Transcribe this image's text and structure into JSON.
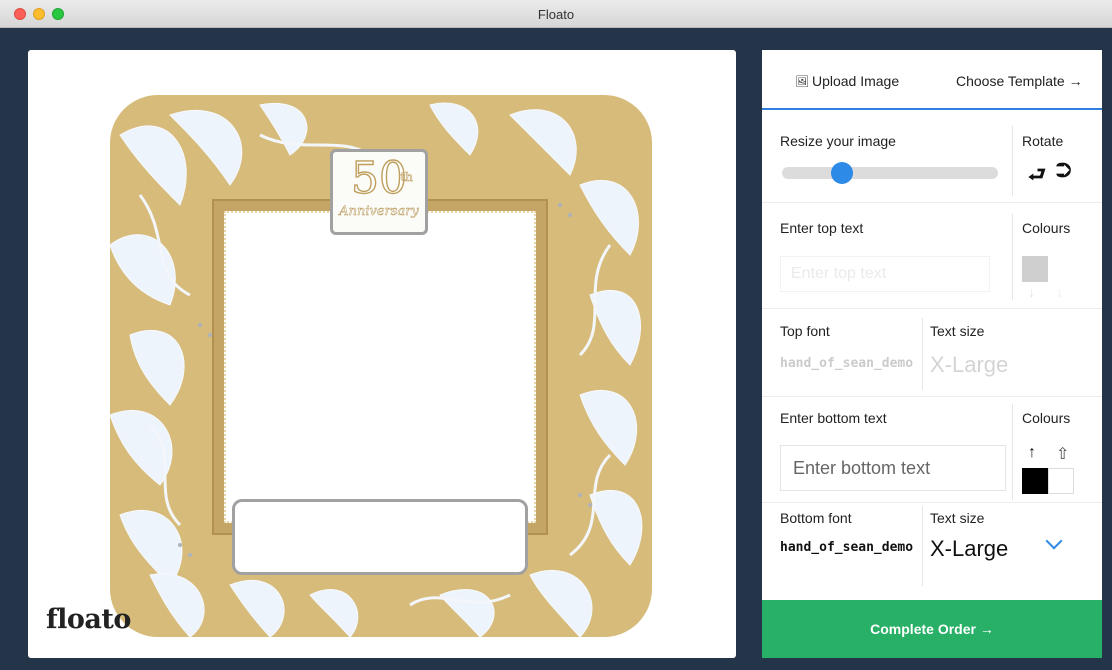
{
  "window": {
    "title": "Floato"
  },
  "design": {
    "badge_number": "50",
    "badge_suffix": "th",
    "badge_word": "Anniversary",
    "logo": "floato",
    "colors": {
      "gold": "#d6bb7b",
      "leaf": "#eef4fb",
      "frame": "#c5a566"
    }
  },
  "tabs": {
    "upload_label": "Upload Image",
    "upload_icon": "image-icon",
    "template_label": "Choose Template →"
  },
  "controls": {
    "resize_label": "Resize your image",
    "resize_level_percent": 25,
    "rotate_label": "Rotate",
    "rotate_left_glyph": "⮐",
    "rotate_right_glyph": "⮊",
    "top_text_label": "Enter top text",
    "top_text_placeholder": "Enter top text",
    "colours_label": "Colours",
    "top_font_label": "Top font",
    "top_font_value": "hand_of_sean_demo",
    "text_size_label": "Text size",
    "top_text_size_value": "X-Large",
    "bottom_text_label": "Enter bottom text",
    "bottom_text_placeholder": "Enter bottom text",
    "bottom_font_label": "Bottom font",
    "bottom_font_value": "hand_of_sean_demo",
    "bottom_text_size_value": "X-Large",
    "arrow_up_solid": "↑",
    "arrow_up_outline": "⇧",
    "arrow_down": "↓",
    "swatch_colors": {
      "top_grey": "#cfcfcf",
      "bottom_black": "#000000",
      "bottom_white": "#ffffff"
    }
  },
  "complete_button": "Complete Order →",
  "accent_colors": {
    "tab_underline": "#2f7fe0",
    "slider": "#2d8ae6",
    "complete": "#27b066"
  }
}
